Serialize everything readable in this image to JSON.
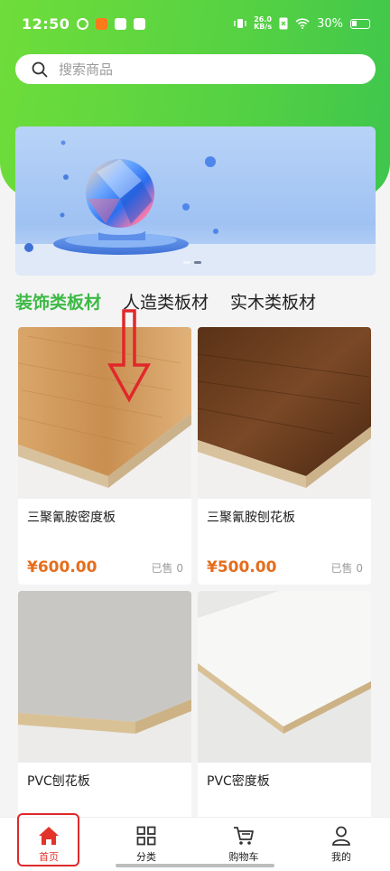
{
  "status_bar": {
    "time": "12:50",
    "net_speed_value": "26.0",
    "net_speed_unit": "KB/s",
    "battery": "30%"
  },
  "search": {
    "placeholder": "搜索商品"
  },
  "banner": {
    "slide_count": 2,
    "active_index": 1
  },
  "category_tabs": [
    {
      "label": "装饰类板材",
      "active": true
    },
    {
      "label": "人造类板材",
      "active": false
    },
    {
      "label": "实木类板材",
      "active": false
    }
  ],
  "products": [
    {
      "name": "三聚氰胺密度板",
      "price": "¥600.00",
      "sold": "已售 0",
      "image": "oak-board"
    },
    {
      "name": "三聚氰胺刨花板",
      "price": "¥500.00",
      "sold": "已售 0",
      "image": "walnut-board"
    },
    {
      "name": "PVC刨花板",
      "price": "",
      "sold": "",
      "image": "grey-board"
    },
    {
      "name": "PVC密度板",
      "price": "",
      "sold": "",
      "image": "white-board"
    }
  ],
  "tab_bar": [
    {
      "label": "首页",
      "icon": "home-icon",
      "active": true
    },
    {
      "label": "分类",
      "icon": "grid-icon",
      "active": false
    },
    {
      "label": "购物车",
      "icon": "cart-icon",
      "active": false
    },
    {
      "label": "我的",
      "icon": "user-icon",
      "active": false
    }
  ],
  "colors": {
    "brand_green": "#55d143",
    "active_tab_green": "#3cb945",
    "price_orange": "#e66d1d",
    "active_nav_red": "#e2342a"
  }
}
